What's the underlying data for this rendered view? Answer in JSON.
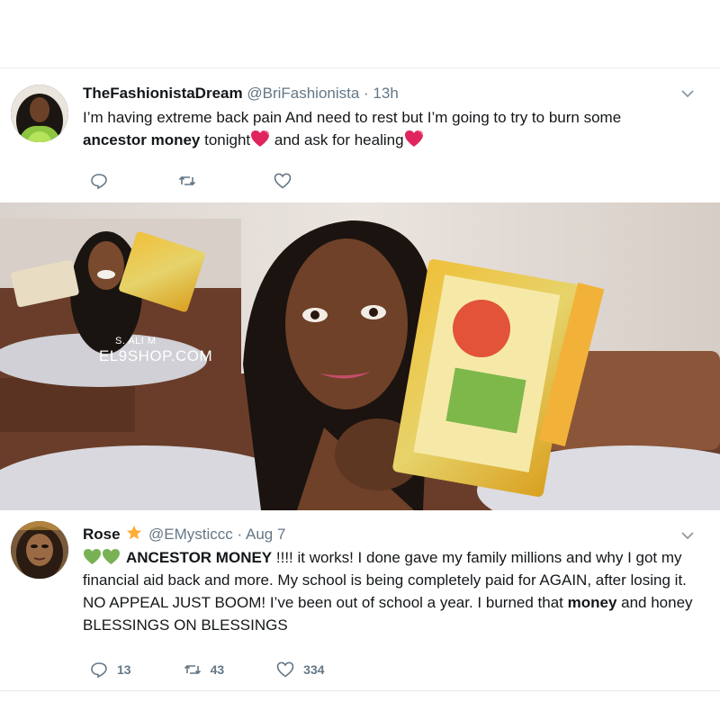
{
  "tweet1": {
    "name": "TheFashionistaDream",
    "meta": "@BriFashionista · 13h",
    "text_line1": "I’m having extreme back pain And need to rest but I’m going to try to burn some",
    "text_bold": "ancestor money",
    "text_mid": " tonight",
    "text_mid2": " and ask for healing",
    "icons": [
      "reply-icon",
      "retweet-icon",
      "like-icon",
      "chevron-down-icon",
      "heart-emoji"
    ]
  },
  "photo": {
    "watermark_line1": "S. ALI M",
    "watermark_line2": "EL9SHOP.COM"
  },
  "tweet2": {
    "name": "Rose",
    "meta": "@EMysticcc · Aug 7",
    "bold_start": "ANCESTOR MONEY",
    "text_a": " !!!! it works! I done gave my family millions and why I got my financial aid back and more. My school is being completely paid for AGAIN, after losing it. NO APPEAL JUST BOOM! I’ve been out of school a year. I burned that ",
    "bold_money": "money",
    "text_b": " and honey BLESSINGS ON BLESSINGS",
    "reply_count": "13",
    "retweet_count": "43",
    "like_count": "334",
    "icons": [
      "star-emoji",
      "green-heart-emoji",
      "reply-icon",
      "retweet-icon",
      "like-icon",
      "chevron-down-icon"
    ]
  },
  "colors": {
    "action_gray": "#657786",
    "text": "#14171a",
    "heart_red": "#e0245e",
    "green_heart": "#77b255",
    "star": "#ffac33"
  }
}
